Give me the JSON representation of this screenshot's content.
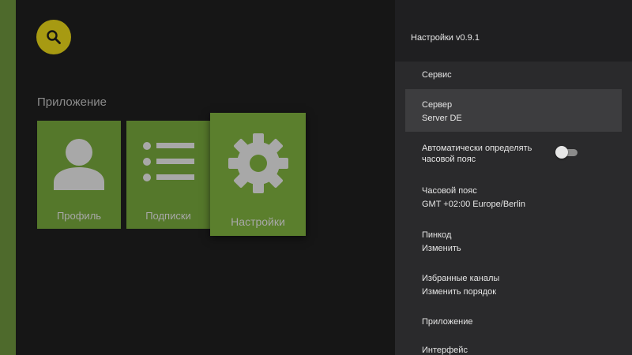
{
  "app": {
    "section_title": "Приложение",
    "tiles": [
      {
        "label": "Профиль",
        "icon": "person-icon"
      },
      {
        "label": "Подписки",
        "icon": "list-icon"
      },
      {
        "label": "Настройки",
        "icon": "gear-icon"
      }
    ]
  },
  "settings": {
    "title": "Настройки v0.9.1",
    "items": [
      {
        "title": "Сервис"
      },
      {
        "title": "Сервер",
        "value": "Server DE"
      },
      {
        "title_line1": "Автоматически определять",
        "title_line2": "часовой пояс",
        "toggle": "off"
      },
      {
        "title": "Часовой пояс",
        "value": "GMT +02:00 Europe/Berlin"
      },
      {
        "title": "Пинкод",
        "value": "Изменить"
      },
      {
        "title": "Избранные каналы",
        "value": "Изменить порядок"
      },
      {
        "title": "Приложение"
      },
      {
        "title": "Интерфейс"
      }
    ]
  },
  "colors": {
    "accent_green": "#55782b",
    "search_yellow": "#a79a12",
    "panel_bg": "#2a2a2c"
  }
}
